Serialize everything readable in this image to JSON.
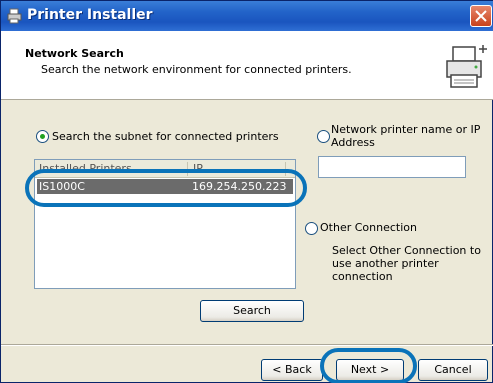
{
  "window": {
    "title": "Printer Installer"
  },
  "header": {
    "title": "Network Search",
    "subtitle": "Search the network environment for connected printers."
  },
  "search_subnet": {
    "label": "Search the subnet for connected printers",
    "selected": true
  },
  "printer_list": {
    "columns": [
      "Installed Printers",
      "IP"
    ],
    "rows": [
      {
        "name": "IS1000C",
        "ip": "169.254.250.223",
        "selected": true
      }
    ]
  },
  "network_name": {
    "label_line1": "Network printer name or IP",
    "label_line2": "Address",
    "value": "",
    "selected": false
  },
  "other_connection": {
    "label": "Other Connection",
    "selected": false,
    "description_line1": "Select Other Connection to",
    "description_line2": "use another printer",
    "description_line3": "connection"
  },
  "buttons": {
    "search": "Search",
    "back": "< Back",
    "next": "Next >",
    "cancel": "Cancel"
  },
  "icons": {
    "title": "printer-installer-icon",
    "header": "printer-add-icon",
    "close": "close-icon"
  },
  "colors": {
    "highlight": "#0a73b9",
    "selected_row": "#6b6b6b",
    "title_bar": "#2364c9"
  }
}
